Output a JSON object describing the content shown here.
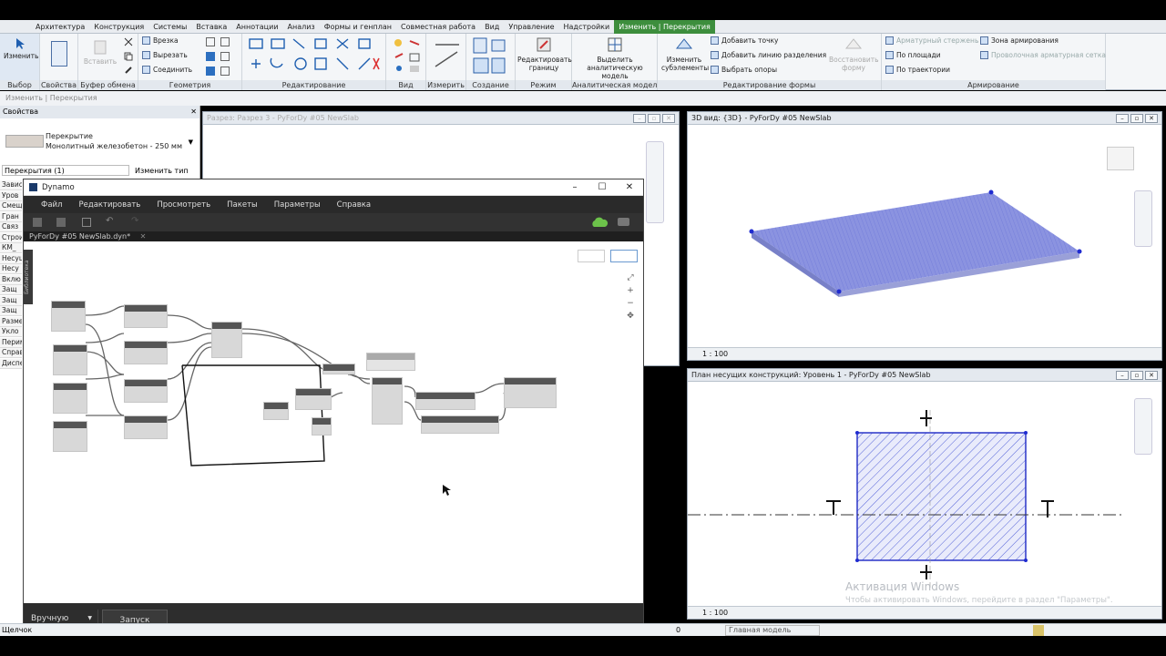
{
  "ribbon_tabs": [
    "Архитектура",
    "Конструкция",
    "Системы",
    "Вставка",
    "Аннотации",
    "Анализ",
    "Формы и генплан",
    "Совместная работа",
    "Вид",
    "Управление",
    "Надстройки",
    "Изменить | Перекрытия"
  ],
  "ribbon_active_tab": "Изменить | Перекрытия",
  "ribbon": {
    "modify_label": "Изменить",
    "paste_label": "Вставить",
    "groups": {
      "select": "Выбор",
      "properties": "Свойства",
      "clipboard": "Буфер обмена",
      "geometry": "Геометрия",
      "edit": "Редактирование",
      "view": "Вид",
      "measure": "Измерить",
      "create": "Создание",
      "mode": "Режим",
      "analytical": "Аналитическая модель",
      "shape_edit": "Редактирование формы",
      "reinforcement": "Армирование"
    },
    "geometry_items": [
      "Врезка",
      "Вырезать",
      "Соединить"
    ],
    "edit_boundary": "Редактировать границу",
    "highlight_analytical": "Выделить аналитическую модель",
    "modify_subelements": "Изменить субэлементы",
    "add_point": "Добавить точку",
    "add_split_line": "Добавить линию разделения",
    "pick_supports": "Выбрать опоры",
    "reset_shape": "Восстановить форму",
    "rebar_items": [
      "Арматурный стержень",
      "По площади",
      "По траектории"
    ],
    "rebar_zone": "Зона армирования",
    "wire_mesh": "Проволочная арматурная сетка"
  },
  "breadcrumb": "Изменить | Перекрытия",
  "properties": {
    "title": "Свойства",
    "type_name": "Перекрытие",
    "type_value": "Монолитный железобетон - 250 мм",
    "filter": "Перекрытия (1)",
    "edit_type": "Изменить тип",
    "rows": [
      "Завис",
      "Уров",
      "Смещ",
      "Гран",
      "Связ",
      "Строи",
      "КМ_",
      "Несущ",
      "Несу",
      "Вклю",
      "Защ",
      "Защ",
      "Защ",
      "Разме",
      "Укло",
      "Перим",
      "Справ",
      "Диспе"
    ]
  },
  "views": {
    "section": {
      "title": "Разрез: Разрез 3 - PyForDy #05 NewSlab"
    },
    "v3d": {
      "title": "3D вид: {3D} - PyForDy #05 NewSlab",
      "scale": "1 : 100"
    },
    "plan": {
      "title": "План несущих конструкций: Уровень 1 - PyForDy #05 NewSlab",
      "scale": "1 : 100"
    }
  },
  "dynamo": {
    "title": "Dynamo",
    "menu": [
      "Файл",
      "Редактировать",
      "Просмотреть",
      "Пакеты",
      "Параметры",
      "Справка"
    ],
    "tab": "PyForDy #05 NewSlab.dyn*",
    "side_label": "Библиотека",
    "run_mode": "Вручную",
    "run_button": "Запуск"
  },
  "statusbar": {
    "left": "Щелчок",
    "model": "Главная модель",
    "zero": "0"
  },
  "watermark": {
    "line1": "Активация Windows",
    "line2": "Чтобы активировать Windows, перейдите в раздел \"Параметры\"."
  },
  "colors": {
    "accent": "#3d8e3d",
    "slab": "#8b93e0",
    "hatch": "#5563d8"
  }
}
